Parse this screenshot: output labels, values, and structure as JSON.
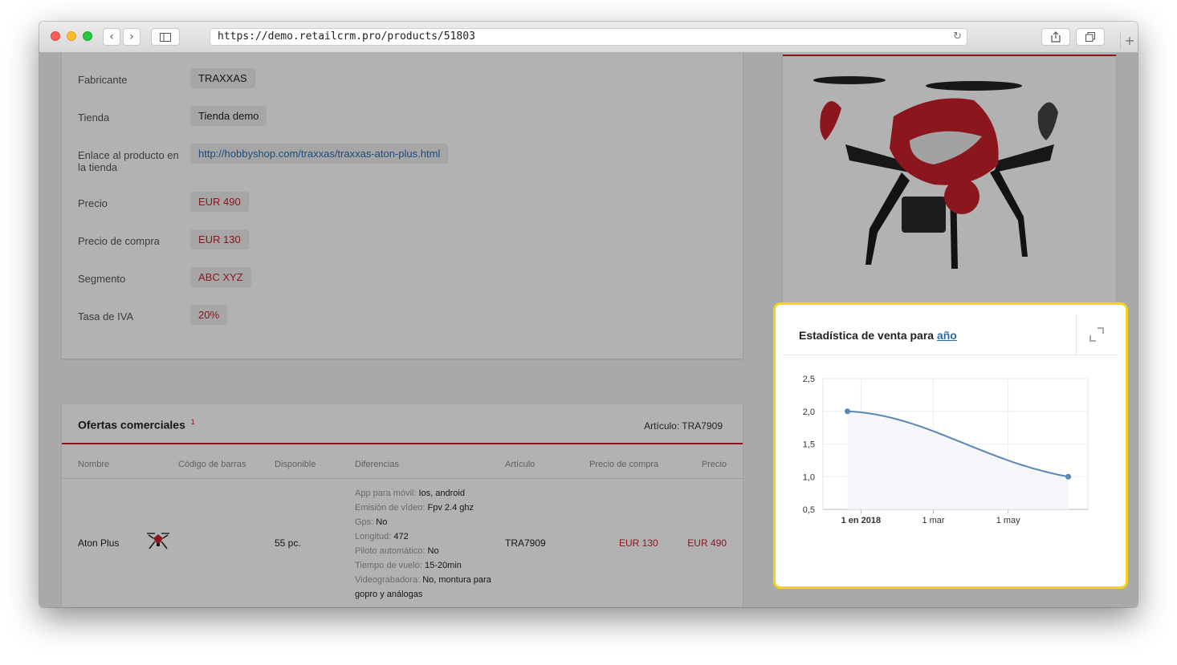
{
  "browser": {
    "url": "https://demo.retailcrm.pro/products/51803"
  },
  "properties": [
    {
      "label": "Fabricante",
      "value": "TRAXXAS",
      "style": "plain"
    },
    {
      "label": "Tienda",
      "value": "Tienda demo",
      "style": "plain"
    },
    {
      "label": "Enlace al producto en la tienda",
      "value": "http://hobbyshop.com/traxxas/traxxas-aton-plus.html",
      "style": "link"
    },
    {
      "label": "Precio",
      "value": "EUR 490",
      "style": "red"
    },
    {
      "label": "Precio de compra",
      "value": "EUR 130",
      "style": "red"
    },
    {
      "label": "Segmento",
      "value": "ABC XYZ",
      "style": "red"
    },
    {
      "label": "Tasa de IVA",
      "value": "20%",
      "style": "red"
    }
  ],
  "offers": {
    "title": "Ofertas comerciales",
    "count": "1",
    "article_header": "Artículo: TRA7909",
    "columns": [
      "Nombre",
      "Código de barras",
      "Disponible",
      "Diferencias",
      "Artículo",
      "Precio de compra",
      "Precio"
    ],
    "row": {
      "name": "Aton Plus",
      "available": "55 pc.",
      "article": "TRA7909",
      "purchase_price": "EUR 130",
      "price": "EUR 490",
      "differences": [
        {
          "key": "App para móvil:",
          "value": "Ios, android"
        },
        {
          "key": "Emisión de vídeo:",
          "value": "Fpv 2.4 ghz"
        },
        {
          "key": "Gps:",
          "value": "No"
        },
        {
          "key": "Longitud:",
          "value": "472"
        },
        {
          "key": "Piloto automático:",
          "value": "No"
        },
        {
          "key": "Tiempo de vuelo:",
          "value": "15-20min"
        },
        {
          "key": "Videograbadora:",
          "value": "No, montura para gopro y análogas"
        }
      ]
    }
  },
  "stats": {
    "title": "Estadística de venta para",
    "period_link": "año"
  },
  "chart_data": {
    "type": "area",
    "title": "",
    "xlabel": "",
    "ylabel": "",
    "x_ticks": [
      "1 en 2018",
      "1 mar",
      "1 may"
    ],
    "y_ticks": [
      "2,5",
      "2,0",
      "1,5",
      "1,0",
      "0,5"
    ],
    "ylim": [
      0.5,
      2.5
    ],
    "grid": true,
    "series": [
      {
        "values": [
          2.0,
          1.0
        ],
        "x": [
          "2017-12-21",
          "2018-06-19"
        ]
      }
    ],
    "color": "#5b87b5"
  },
  "colors": {
    "accent_red": "#c8202b",
    "link_blue": "#2b6cb0",
    "highlight": "#f7d21b"
  }
}
